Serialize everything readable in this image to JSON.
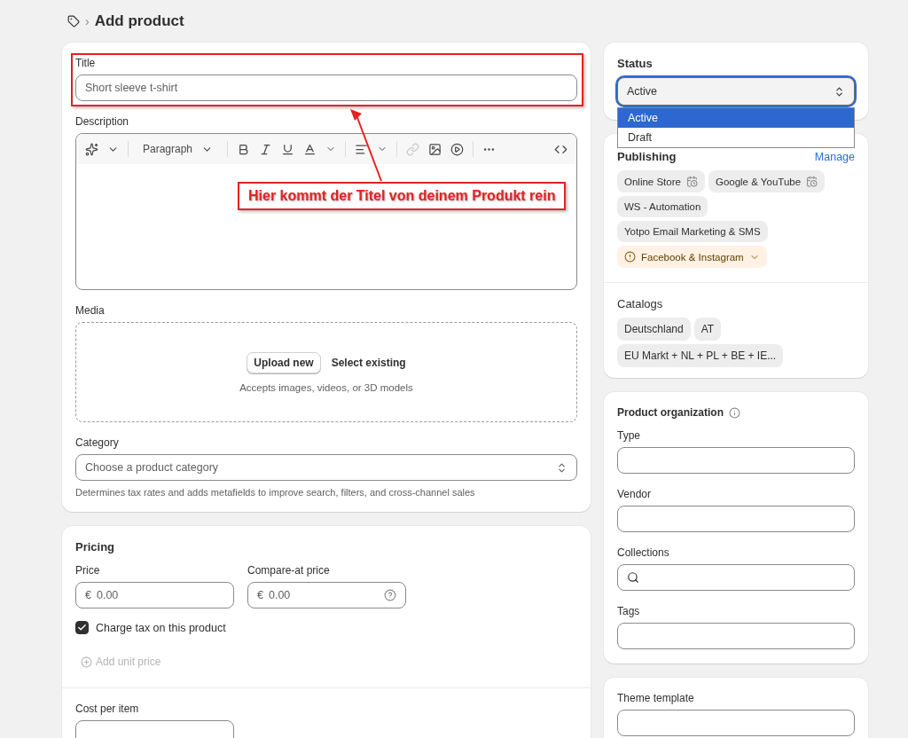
{
  "breadcrumb": {
    "separator": "›",
    "title": "Add product"
  },
  "main": {
    "title_field": {
      "label": "Title",
      "placeholder": "Short sleeve t-shirt"
    },
    "description": {
      "label": "Description",
      "format": "Paragraph"
    },
    "media": {
      "label": "Media",
      "upload": "Upload new",
      "select": "Select existing",
      "hint": "Accepts images, videos, or 3D models"
    },
    "category": {
      "label": "Category",
      "placeholder": "Choose a product category",
      "help": "Determines tax rates and adds metafields to improve search, filters, and cross-channel sales"
    }
  },
  "pricing": {
    "title": "Pricing",
    "fields": [
      {
        "label": "Price",
        "currency": "€",
        "placeholder": "0.00",
        "help_icon": false
      },
      {
        "label": "Compare-at price",
        "currency": "€",
        "placeholder": "0.00",
        "help_icon": true
      }
    ],
    "charge_tax": {
      "label": "Charge tax on this product",
      "checked": true
    },
    "add_unit_price": {
      "label": "Add unit price",
      "disabled": true
    },
    "cost": {
      "label": "Cost per item"
    }
  },
  "status": {
    "label": "Status",
    "value": "Active",
    "expanded": true,
    "options": [
      {
        "label": "Active",
        "selected": true
      },
      {
        "label": "Draft",
        "selected": false
      }
    ]
  },
  "publishing": {
    "title": "Publishing",
    "manage": "Manage",
    "channels": [
      {
        "label": "Online Store",
        "kind": "scheduled"
      },
      {
        "label": "Google & YouTube",
        "kind": "scheduled"
      },
      {
        "label": "WS - Automation",
        "kind": "plain"
      },
      {
        "label": "Yotpo Email Marketing & SMS",
        "kind": "plain"
      },
      {
        "label": "Facebook & Instagram",
        "kind": "warning"
      }
    ]
  },
  "catalogs": {
    "title": "Catalogs",
    "items": [
      "Deutschland",
      "AT",
      "EU Markt + NL + PL + BE + IE..."
    ]
  },
  "organization": {
    "title": "Product organization",
    "fields": [
      {
        "label": "Type",
        "kind": "text"
      },
      {
        "label": "Vendor",
        "kind": "text"
      },
      {
        "label": "Collections",
        "kind": "search"
      },
      {
        "label": "Tags",
        "kind": "text"
      }
    ]
  },
  "theme": {
    "label": "Theme template"
  },
  "annotation": {
    "text": "Hier kommt der Titel von deinem Produkt rein"
  }
}
